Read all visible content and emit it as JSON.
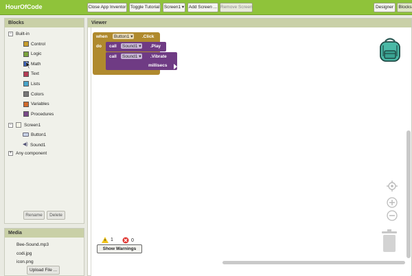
{
  "app": {
    "title": "HourOfCode"
  },
  "toolbar": {
    "close_app_inventor": "Close App Inventor",
    "toggle_tutorial": "Toggle Tutorial",
    "screen_select": "Screen1 ▾",
    "add_screen": "Add Screen ...",
    "remove_screen": "Remove Screen",
    "designer": "Designer",
    "blocks": "Blocks"
  },
  "blocks_panel": {
    "title": "Blocks",
    "builtin_label": "Built-in",
    "builtin": [
      {
        "label": "Control",
        "color": "#c69d2c"
      },
      {
        "label": "Logic",
        "color": "#7aa33b"
      },
      {
        "label": "Math",
        "color": "#3c63b8"
      },
      {
        "label": "Text",
        "color": "#b53d55"
      },
      {
        "label": "Lists",
        "color": "#48a4c9"
      },
      {
        "label": "Colors",
        "color": "#777777"
      },
      {
        "label": "Variables",
        "color": "#d16a2b"
      },
      {
        "label": "Procedures",
        "color": "#7a4a88"
      }
    ],
    "screen_label": "Screen1",
    "components": [
      {
        "label": "Button1"
      },
      {
        "label": "Sound1"
      }
    ],
    "any_component": "Any component",
    "rename": "Rename",
    "delete": "Delete"
  },
  "media_panel": {
    "title": "Media",
    "files": [
      "Bee-Sound.mp3",
      "codi.jpg",
      "icon.png"
    ],
    "upload": "Upload File ..."
  },
  "viewer": {
    "title": "Viewer",
    "event_block": {
      "when": "when",
      "component": "Button1 ▾",
      "event": ".Click",
      "do": "do"
    },
    "call_play": {
      "call": "call",
      "component": "Sound1 ▾",
      "method": ".Play"
    },
    "call_vibrate": {
      "call": "call",
      "component": "Sound1 ▾",
      "method": ".Vibrate",
      "param": "millisecs"
    },
    "warnings_count": "1",
    "errors_count": "0",
    "show_warnings": "Show Warnings"
  }
}
